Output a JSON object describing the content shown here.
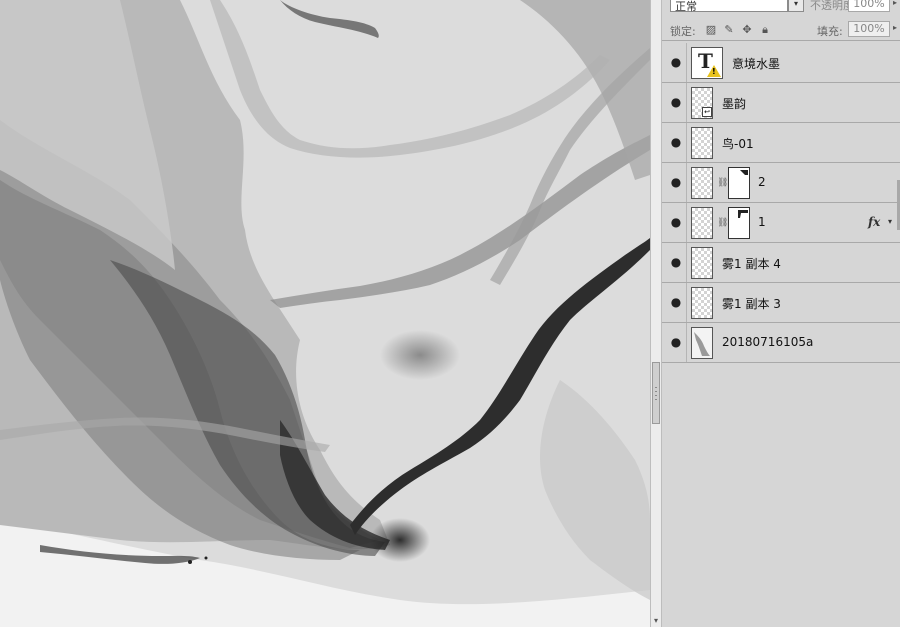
{
  "layers_panel": {
    "blend_mode": "正常",
    "opacity_label": "不透明度:",
    "opacity_value": "100%",
    "lock_label": "锁定:",
    "fill_label": "填充:",
    "fill_value": "100%",
    "layers": [
      {
        "name": "意境水墨",
        "kind": "text",
        "warning": true
      },
      {
        "name": "墨韵",
        "kind": "smart-object"
      },
      {
        "name": "鸟-01",
        "kind": "pixel"
      },
      {
        "name": "2",
        "kind": "masked"
      },
      {
        "name": "1",
        "kind": "masked",
        "has_fx": true
      },
      {
        "name": "雾1 副本 4",
        "kind": "pixel"
      },
      {
        "name": "雾1 副本 3",
        "kind": "pixel"
      },
      {
        "name": "20180716105a",
        "kind": "image"
      }
    ]
  },
  "icons": {
    "visibility": "eye-icon",
    "link": "chain-link-icon",
    "fx": "fx-icon",
    "text_layer": "text-layer-icon",
    "warning": "warning-icon",
    "lock_transparent": "lock-transparent-icon",
    "lock_paint": "brush-icon",
    "lock_move": "move-icon",
    "lock_all": "lock-icon"
  },
  "colors": {
    "panel_bg": "#d6d6d6",
    "canvas_bg": "#ffffff",
    "ink_dark": "#2a2a2a",
    "ink_mid": "#8c8c8c",
    "ink_light": "#cfcfcf"
  }
}
